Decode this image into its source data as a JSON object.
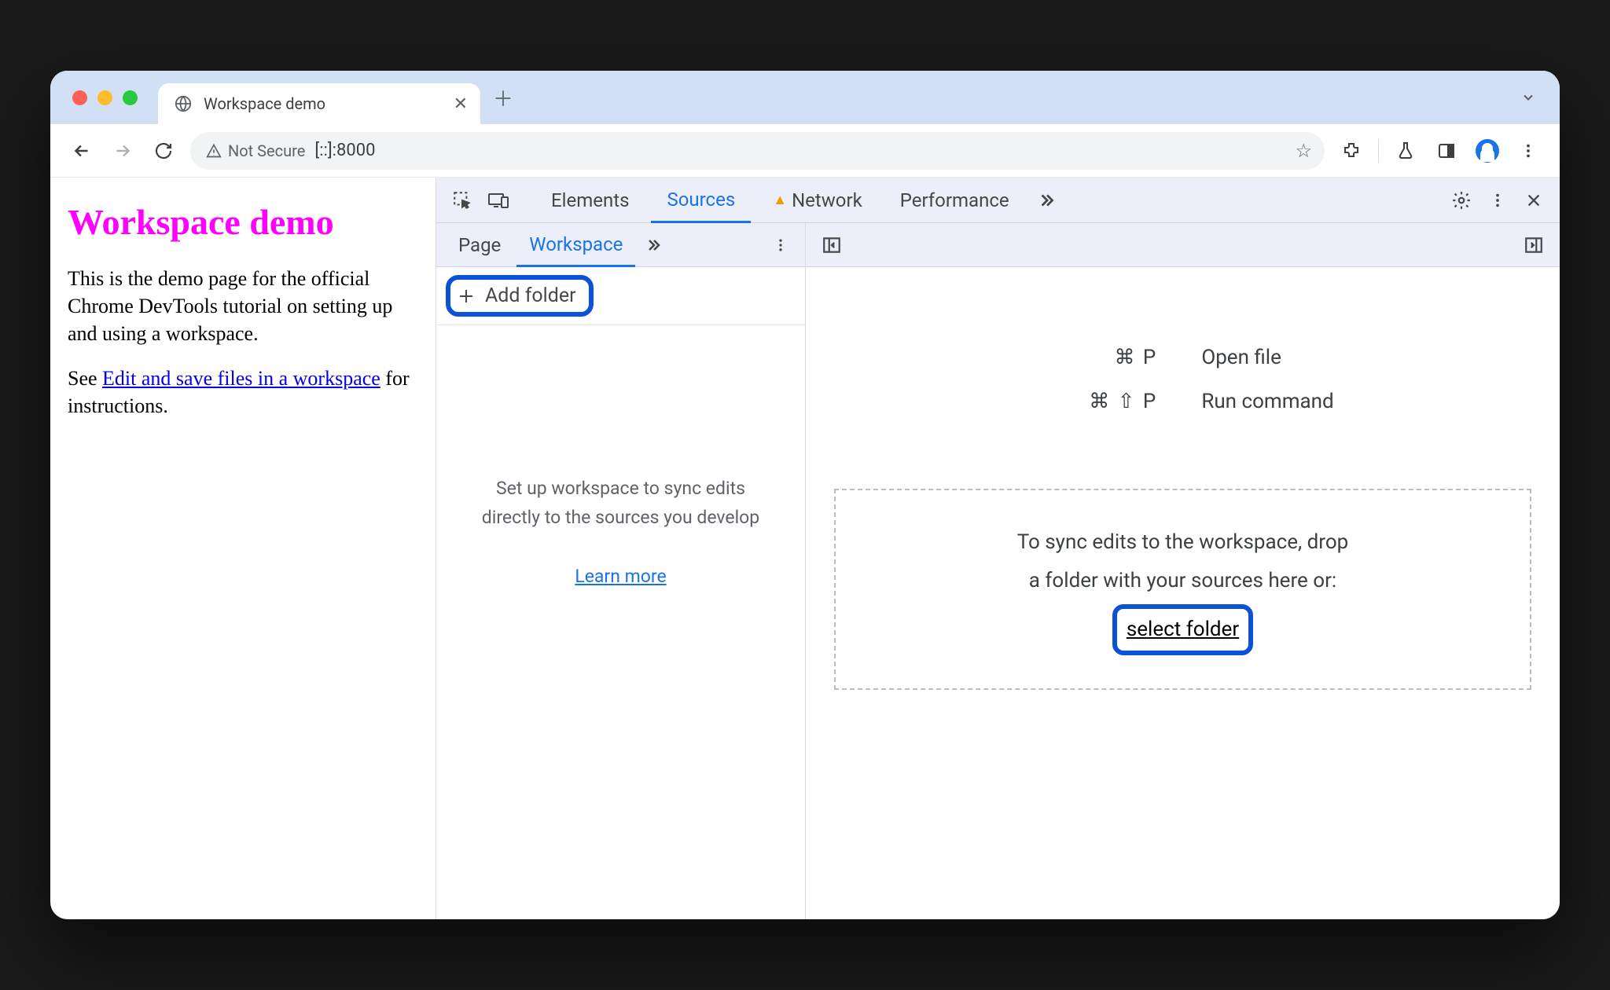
{
  "browser": {
    "tab_title": "Workspace demo",
    "not_secure_label": "Not Secure",
    "url": "[::]:8000"
  },
  "page": {
    "heading": "Workspace demo",
    "para1": "This is the demo page for the official Chrome DevTools tutorial on setting up and using a workspace.",
    "para2_prefix": "See ",
    "para2_link": "Edit and save files in a workspace",
    "para2_suffix": " for instructions."
  },
  "devtools": {
    "tabs": {
      "elements": "Elements",
      "sources": "Sources",
      "network": "Network",
      "performance": "Performance"
    },
    "sources": {
      "subtabs": {
        "page": "Page",
        "workspace": "Workspace"
      },
      "add_folder": "Add folder",
      "help_text": "Set up workspace to sync edits directly to the sources you develop",
      "learn_more": "Learn more"
    },
    "editor": {
      "shortcut_open_keys": "⌘  P",
      "shortcut_open_label": "Open file",
      "shortcut_cmd_keys": "⌘ ⇧  P",
      "shortcut_cmd_label": "Run command",
      "drop_text_line1": "To sync edits to the workspace, drop",
      "drop_text_line2": "a folder with your sources here or:",
      "select_folder": "select folder"
    }
  }
}
